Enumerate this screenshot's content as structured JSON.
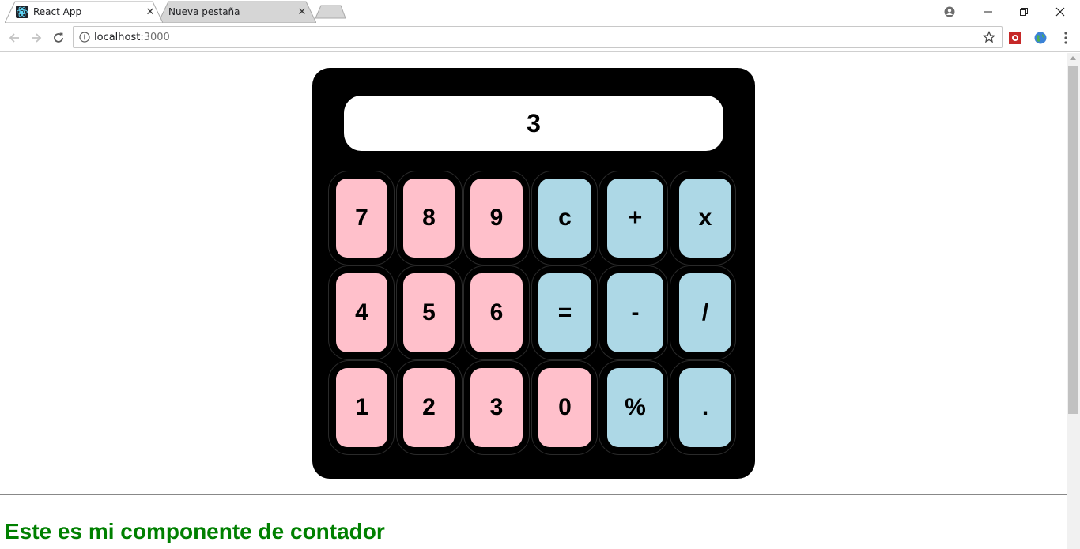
{
  "browser": {
    "tabs": [
      {
        "title": "React App",
        "active": true
      },
      {
        "title": "Nueva pestaña",
        "active": false
      }
    ],
    "address": {
      "host": "localhost",
      "port": ":3000"
    }
  },
  "calculator": {
    "display": "3",
    "keys": [
      {
        "label": "7",
        "color": "#ffc0cb"
      },
      {
        "label": "8",
        "color": "#ffc0cb"
      },
      {
        "label": "9",
        "color": "#ffc0cb"
      },
      {
        "label": "c",
        "color": "#add8e6"
      },
      {
        "label": "+",
        "color": "#add8e6"
      },
      {
        "label": "x",
        "color": "#add8e6"
      },
      {
        "label": "4",
        "color": "#ffc0cb"
      },
      {
        "label": "5",
        "color": "#ffc0cb"
      },
      {
        "label": "6",
        "color": "#ffc0cb"
      },
      {
        "label": "=",
        "color": "#add8e6"
      },
      {
        "label": "-",
        "color": "#add8e6"
      },
      {
        "label": "/",
        "color": "#add8e6"
      },
      {
        "label": "1",
        "color": "#ffc0cb"
      },
      {
        "label": "2",
        "color": "#ffc0cb"
      },
      {
        "label": "3",
        "color": "#ffc0cb"
      },
      {
        "label": "0",
        "color": "#ffc0cb"
      },
      {
        "label": "%",
        "color": "#add8e6"
      },
      {
        "label": ".",
        "color": "#add8e6"
      }
    ]
  },
  "counter": {
    "heading": "Este es mi componente de contador",
    "heading_color": "#008000"
  },
  "colors": {
    "calculator_body": "#000000",
    "digit_key": "#ffc0cb",
    "operator_key": "#add8e6"
  }
}
